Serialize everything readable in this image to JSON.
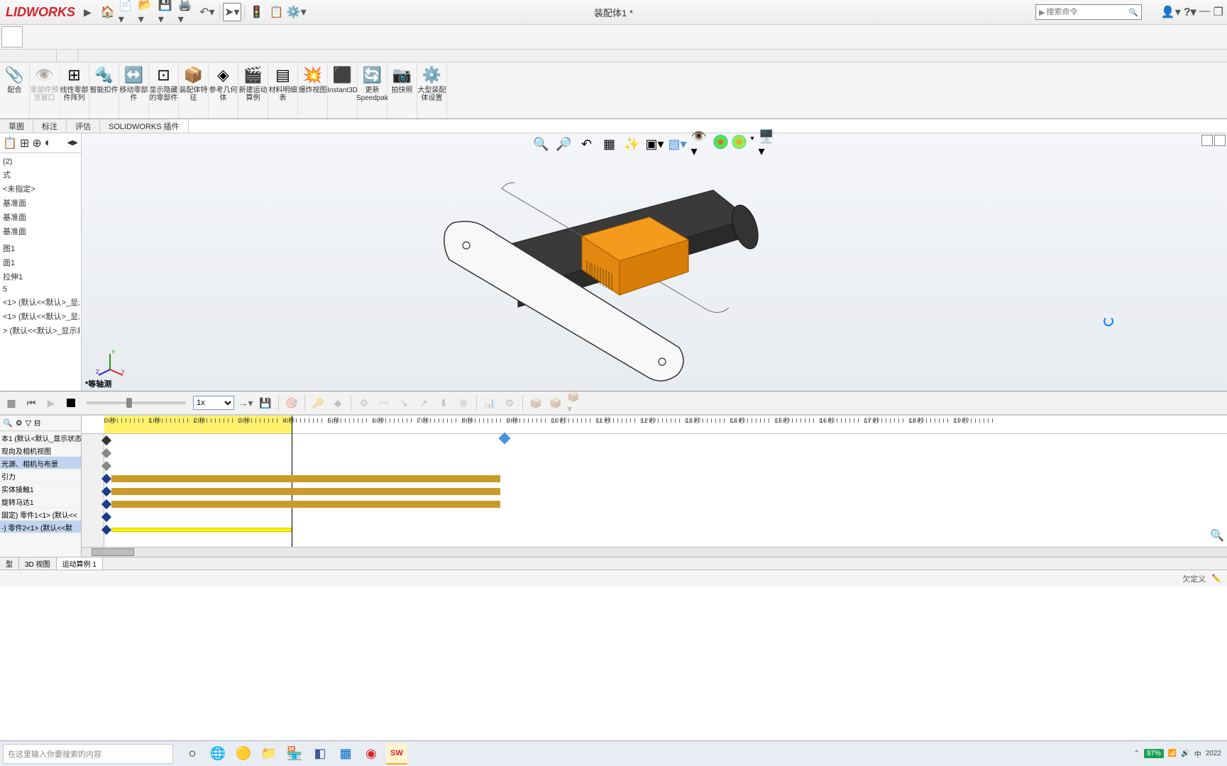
{
  "logo": "LIDWORKS",
  "doc_title": "装配体1 *",
  "search": {
    "placeholder": "搜索命令"
  },
  "ribbon": [
    {
      "label": "配合",
      "icon": "📎",
      "en": true
    },
    {
      "label": "零部件预览窗口",
      "icon": "👁️",
      "en": false
    },
    {
      "label": "线性零部件阵列",
      "icon": "⊞",
      "en": true
    },
    {
      "label": "智能扣件",
      "icon": "🔩",
      "en": true
    },
    {
      "label": "移动零部件",
      "icon": "↔️",
      "en": true
    },
    {
      "label": "显示隐藏的零部件",
      "icon": "⊡",
      "en": true
    },
    {
      "label": "装配体特征",
      "icon": "📦",
      "en": true
    },
    {
      "label": "参考几何体",
      "icon": "◈",
      "en": true
    },
    {
      "label": "新建运动算例",
      "icon": "🎬",
      "en": true
    },
    {
      "label": "材料明细表",
      "icon": "▤",
      "en": true
    },
    {
      "label": "爆炸视图",
      "icon": "💥",
      "en": true
    },
    {
      "label": "Instant3D",
      "icon": "⬛",
      "en": true
    },
    {
      "label": "更新Speedpak",
      "icon": "🔄",
      "en": true
    },
    {
      "label": "拍快照",
      "icon": "📷",
      "en": true
    },
    {
      "label": "大型装配体设置",
      "icon": "⚙️",
      "en": true
    }
  ],
  "cmd_tabs": [
    "草图",
    "标注",
    "评估",
    "SOLIDWORKS 插件"
  ],
  "tree_items": [
    "(2)",
    "式",
    "<未指定>",
    "基准面",
    "基准面",
    "基准面",
    "",
    "图1",
    "面1",
    "拉伸1",
    "5",
    "<1> (默认<<默认>_显示",
    "<1> (默认<<默认>_显示",
    "> (默认<<默认>_显示状"
  ],
  "iso_label": "*等轴测",
  "speed_select": "1x",
  "timeline": {
    "ruler_ticks": [
      "0 秒",
      "1 秒",
      "2 秒",
      "3 秒",
      "4 秒",
      "5 秒",
      "6 秒",
      "7 秒",
      "8 秒",
      "9 秒",
      "10 秒",
      "11 秒",
      "12 秒",
      "13 秒",
      "14 秒",
      "15 秒",
      "16 秒",
      "17 秒",
      "18 秒",
      "19 秒"
    ],
    "rows": [
      {
        "label": "本1 (默认<默认_显示状态",
        "sel": false
      },
      {
        "label": "现向及相机视图",
        "sel": false
      },
      {
        "label": "光源、相机与布景",
        "sel": true
      },
      {
        "label": "引力",
        "sel": false
      },
      {
        "label": "实体接触1",
        "sel": false
      },
      {
        "label": "旋转马达1",
        "sel": false
      },
      {
        "label": "固定) 零件1<1> (默认<<",
        "sel": false
      },
      {
        "label": "-) 零件2<1> (默认<<默",
        "sel": true
      }
    ]
  },
  "bottom_tabs": [
    "型",
    "3D 视图",
    "运动算例 1"
  ],
  "status_text": "欠定义",
  "taskbar": {
    "search_placeholder": "在这里输入你要搜索的内容",
    "battery": "97%",
    "lang": "中",
    "year": "2022"
  }
}
